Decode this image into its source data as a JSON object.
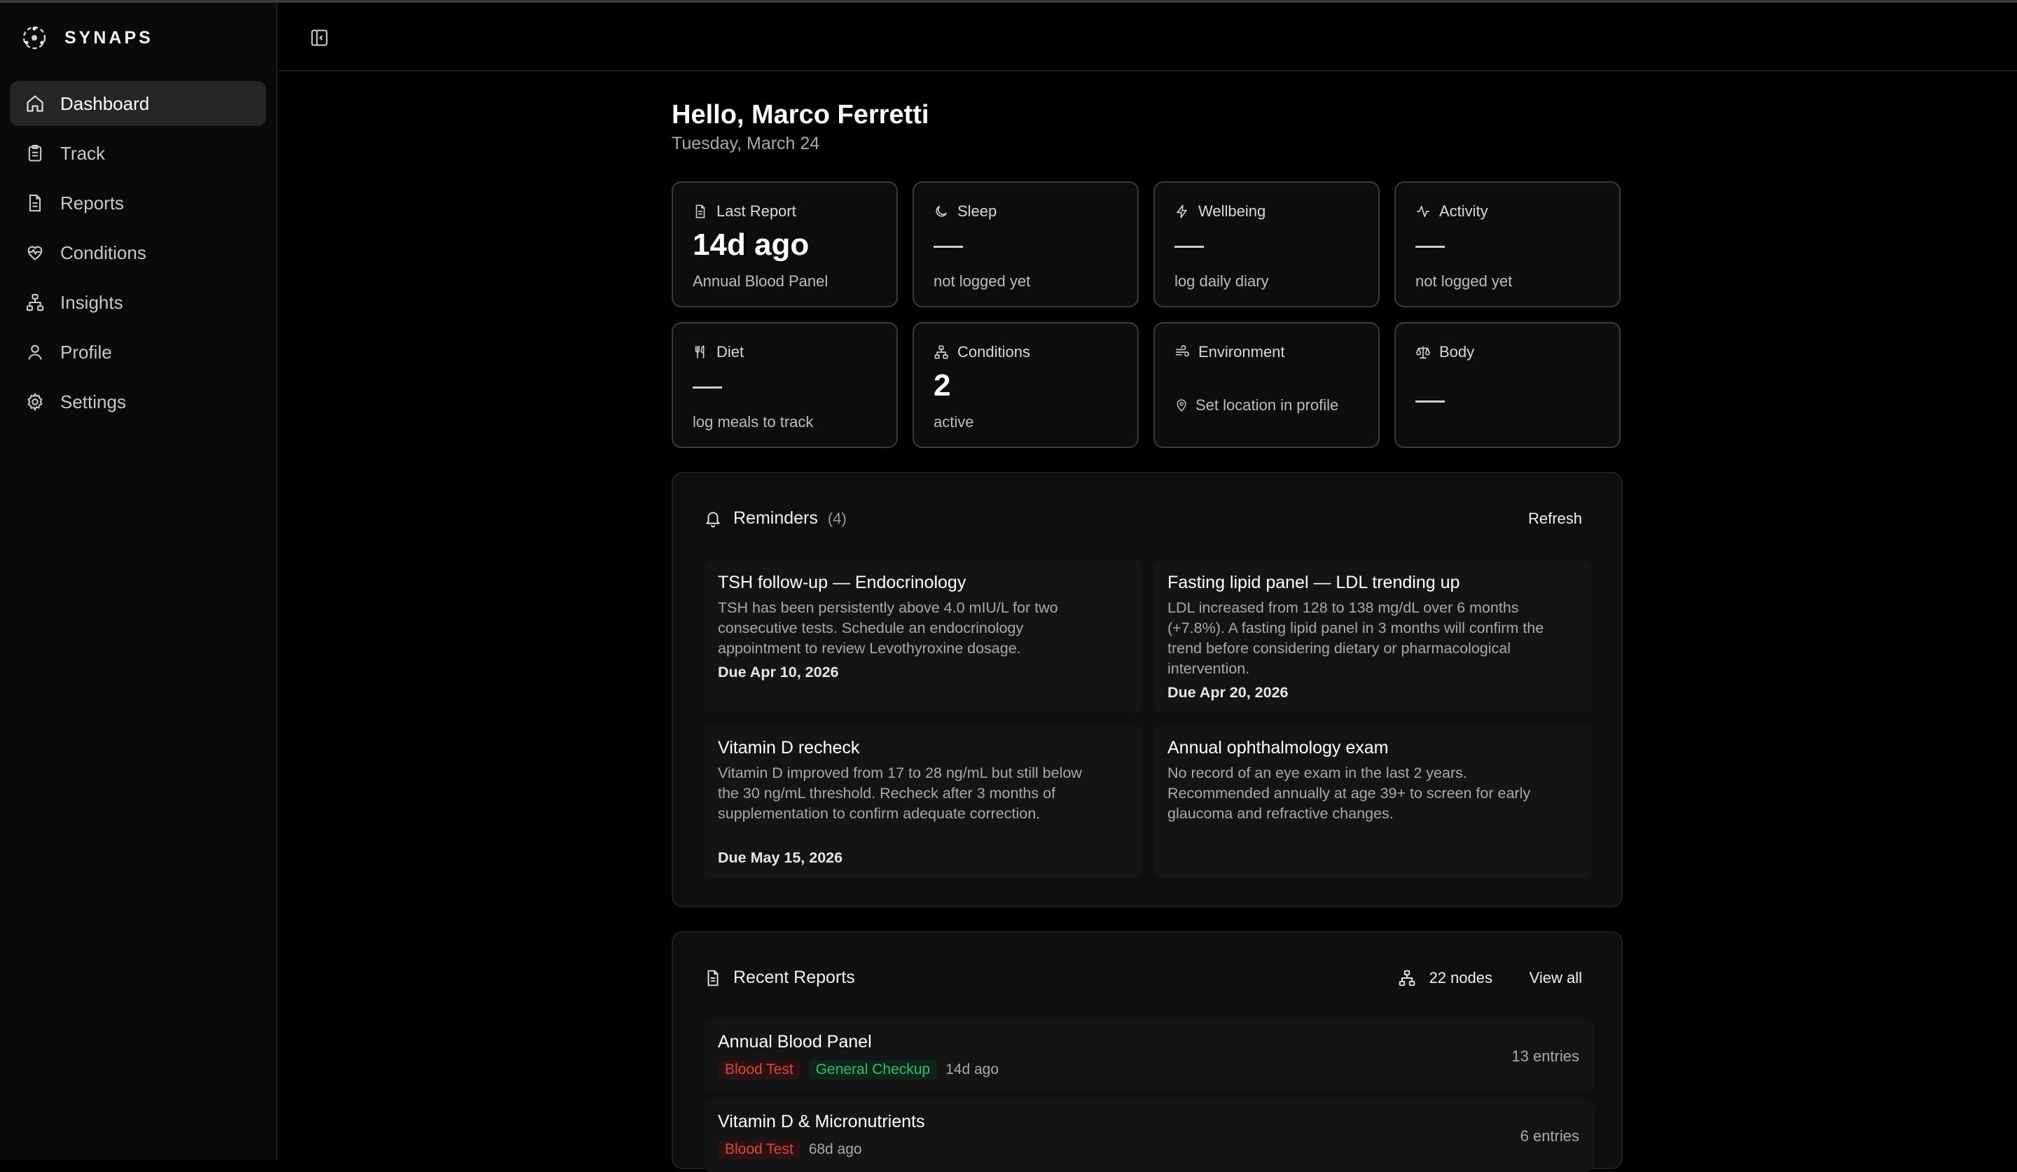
{
  "app": {
    "name": "SYNAPS"
  },
  "sidebar": {
    "items": [
      {
        "label": "Dashboard",
        "icon": "home-icon",
        "active": true
      },
      {
        "label": "Track",
        "icon": "clipboard-icon"
      },
      {
        "label": "Reports",
        "icon": "file-text-icon"
      },
      {
        "label": "Conditions",
        "icon": "heart-pulse-icon"
      },
      {
        "label": "Insights",
        "icon": "network-icon"
      },
      {
        "label": "Profile",
        "icon": "user-icon"
      },
      {
        "label": "Settings",
        "icon": "gear-icon"
      }
    ]
  },
  "header": {
    "toggle_icon": "sidebar-toggle-icon"
  },
  "greeting": {
    "title": "Hello, Marco Ferretti",
    "date": "Tuesday, March 24"
  },
  "stats": {
    "last_report": {
      "label": "Last Report",
      "value": "14d ago",
      "sub": "Annual Blood Panel"
    },
    "sleep": {
      "label": "Sleep",
      "sub": "not logged yet"
    },
    "wellbeing": {
      "label": "Wellbeing",
      "sub": "log daily diary"
    },
    "activity": {
      "label": "Activity",
      "sub": "not logged yet"
    },
    "diet": {
      "label": "Diet",
      "sub": "log meals to track"
    },
    "conditions": {
      "label": "Conditions",
      "value": "2",
      "sub": "active"
    },
    "environment": {
      "label": "Environment",
      "sub": "Set location in profile"
    },
    "body": {
      "label": "Body"
    }
  },
  "reminders": {
    "title": "Reminders",
    "count": "(4)",
    "refresh_label": "Refresh",
    "items": [
      {
        "title": "TSH follow-up — Endocrinology",
        "desc": "TSH has been persistently above 4.0 mIU/L for two consecutive tests. Schedule an endocrinology appointment to review Levothyroxine dosage.",
        "due": "Due Apr 10, 2026"
      },
      {
        "title": "Fasting lipid panel — LDL trending up",
        "desc": "LDL increased from 128 to 138 mg/dL over 6 months (+7.8%). A fasting lipid panel in 3 months will confirm the trend before considering dietary or pharmacological intervention.",
        "due": "Due Apr 20, 2026"
      },
      {
        "title": "Vitamin D recheck",
        "desc": "Vitamin D improved from 17 to 28 ng/mL but still below the 30 ng/mL threshold. Recheck after 3 months of supplementation to confirm adequate correction.",
        "due": "Due May 15, 2026"
      },
      {
        "title": "Annual ophthalmology exam",
        "desc": "No record of an eye exam in the last 2 years. Recommended annually at age 39+ to screen for early glaucoma and refractive changes.",
        "due": ""
      }
    ]
  },
  "recent_reports": {
    "title": "Recent Reports",
    "nodes_label": "22 nodes",
    "view_all_label": "View all",
    "items": [
      {
        "name": "Annual Blood Panel",
        "tag1": "Blood Test",
        "tag2": "General Checkup",
        "ago": "14d ago",
        "entries": "13 entries"
      },
      {
        "name": "Vitamin D & Micronutrients",
        "tag1": "Blood Test",
        "ago": "68d ago",
        "entries": "6 entries"
      }
    ]
  },
  "colors": {
    "tag_red": "#e0443e",
    "tag_green": "#2fbf76",
    "active_nav": "#262626"
  }
}
